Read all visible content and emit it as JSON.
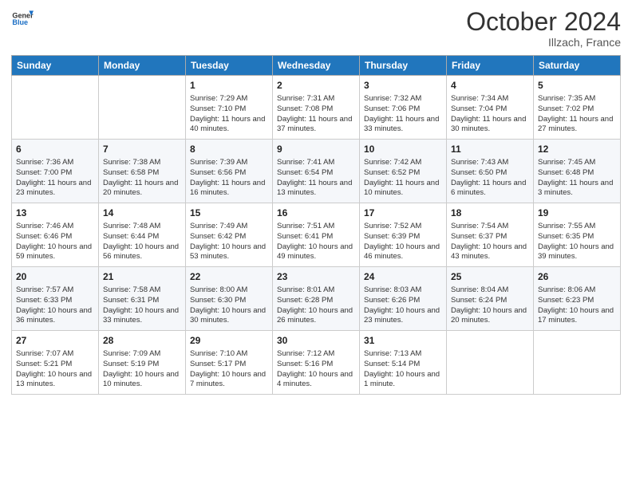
{
  "header": {
    "logo_line1": "General",
    "logo_line2": "Blue",
    "month": "October 2024",
    "location": "Illzach, France"
  },
  "days_of_week": [
    "Sunday",
    "Monday",
    "Tuesday",
    "Wednesday",
    "Thursday",
    "Friday",
    "Saturday"
  ],
  "weeks": [
    [
      {
        "day": "",
        "content": ""
      },
      {
        "day": "",
        "content": ""
      },
      {
        "day": "1",
        "content": "Sunrise: 7:29 AM\nSunset: 7:10 PM\nDaylight: 11 hours and 40 minutes."
      },
      {
        "day": "2",
        "content": "Sunrise: 7:31 AM\nSunset: 7:08 PM\nDaylight: 11 hours and 37 minutes."
      },
      {
        "day": "3",
        "content": "Sunrise: 7:32 AM\nSunset: 7:06 PM\nDaylight: 11 hours and 33 minutes."
      },
      {
        "day": "4",
        "content": "Sunrise: 7:34 AM\nSunset: 7:04 PM\nDaylight: 11 hours and 30 minutes."
      },
      {
        "day": "5",
        "content": "Sunrise: 7:35 AM\nSunset: 7:02 PM\nDaylight: 11 hours and 27 minutes."
      }
    ],
    [
      {
        "day": "6",
        "content": "Sunrise: 7:36 AM\nSunset: 7:00 PM\nDaylight: 11 hours and 23 minutes."
      },
      {
        "day": "7",
        "content": "Sunrise: 7:38 AM\nSunset: 6:58 PM\nDaylight: 11 hours and 20 minutes."
      },
      {
        "day": "8",
        "content": "Sunrise: 7:39 AM\nSunset: 6:56 PM\nDaylight: 11 hours and 16 minutes."
      },
      {
        "day": "9",
        "content": "Sunrise: 7:41 AM\nSunset: 6:54 PM\nDaylight: 11 hours and 13 minutes."
      },
      {
        "day": "10",
        "content": "Sunrise: 7:42 AM\nSunset: 6:52 PM\nDaylight: 11 hours and 10 minutes."
      },
      {
        "day": "11",
        "content": "Sunrise: 7:43 AM\nSunset: 6:50 PM\nDaylight: 11 hours and 6 minutes."
      },
      {
        "day": "12",
        "content": "Sunrise: 7:45 AM\nSunset: 6:48 PM\nDaylight: 11 hours and 3 minutes."
      }
    ],
    [
      {
        "day": "13",
        "content": "Sunrise: 7:46 AM\nSunset: 6:46 PM\nDaylight: 10 hours and 59 minutes."
      },
      {
        "day": "14",
        "content": "Sunrise: 7:48 AM\nSunset: 6:44 PM\nDaylight: 10 hours and 56 minutes."
      },
      {
        "day": "15",
        "content": "Sunrise: 7:49 AM\nSunset: 6:42 PM\nDaylight: 10 hours and 53 minutes."
      },
      {
        "day": "16",
        "content": "Sunrise: 7:51 AM\nSunset: 6:41 PM\nDaylight: 10 hours and 49 minutes."
      },
      {
        "day": "17",
        "content": "Sunrise: 7:52 AM\nSunset: 6:39 PM\nDaylight: 10 hours and 46 minutes."
      },
      {
        "day": "18",
        "content": "Sunrise: 7:54 AM\nSunset: 6:37 PM\nDaylight: 10 hours and 43 minutes."
      },
      {
        "day": "19",
        "content": "Sunrise: 7:55 AM\nSunset: 6:35 PM\nDaylight: 10 hours and 39 minutes."
      }
    ],
    [
      {
        "day": "20",
        "content": "Sunrise: 7:57 AM\nSunset: 6:33 PM\nDaylight: 10 hours and 36 minutes."
      },
      {
        "day": "21",
        "content": "Sunrise: 7:58 AM\nSunset: 6:31 PM\nDaylight: 10 hours and 33 minutes."
      },
      {
        "day": "22",
        "content": "Sunrise: 8:00 AM\nSunset: 6:30 PM\nDaylight: 10 hours and 30 minutes."
      },
      {
        "day": "23",
        "content": "Sunrise: 8:01 AM\nSunset: 6:28 PM\nDaylight: 10 hours and 26 minutes."
      },
      {
        "day": "24",
        "content": "Sunrise: 8:03 AM\nSunset: 6:26 PM\nDaylight: 10 hours and 23 minutes."
      },
      {
        "day": "25",
        "content": "Sunrise: 8:04 AM\nSunset: 6:24 PM\nDaylight: 10 hours and 20 minutes."
      },
      {
        "day": "26",
        "content": "Sunrise: 8:06 AM\nSunset: 6:23 PM\nDaylight: 10 hours and 17 minutes."
      }
    ],
    [
      {
        "day": "27",
        "content": "Sunrise: 7:07 AM\nSunset: 5:21 PM\nDaylight: 10 hours and 13 minutes."
      },
      {
        "day": "28",
        "content": "Sunrise: 7:09 AM\nSunset: 5:19 PM\nDaylight: 10 hours and 10 minutes."
      },
      {
        "day": "29",
        "content": "Sunrise: 7:10 AM\nSunset: 5:17 PM\nDaylight: 10 hours and 7 minutes."
      },
      {
        "day": "30",
        "content": "Sunrise: 7:12 AM\nSunset: 5:16 PM\nDaylight: 10 hours and 4 minutes."
      },
      {
        "day": "31",
        "content": "Sunrise: 7:13 AM\nSunset: 5:14 PM\nDaylight: 10 hours and 1 minute."
      },
      {
        "day": "",
        "content": ""
      },
      {
        "day": "",
        "content": ""
      }
    ]
  ]
}
